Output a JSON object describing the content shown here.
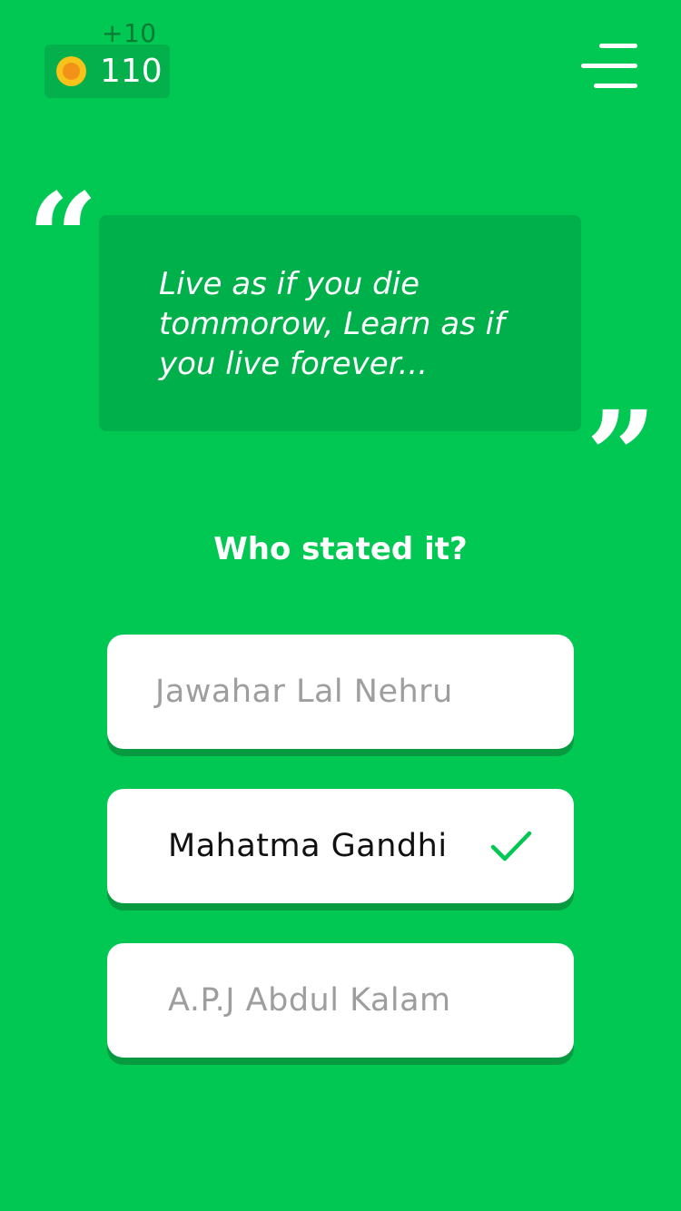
{
  "score": {
    "delta": "+10",
    "coins": "110",
    "coin_icon": "coin-icon"
  },
  "menu": {
    "icon": "menu-icon"
  },
  "quote": {
    "open_mark": "“",
    "close_mark": "”",
    "text": "Live as if you die tommorow, Learn as if you live forever..."
  },
  "question": "Who stated it?",
  "options": [
    {
      "label": "Jawahar Lal Nehru",
      "state": "unselected"
    },
    {
      "label": "Mahatma Gandhi",
      "state": "correct"
    },
    {
      "label": "A.P.J Abdul Kalam",
      "state": "unselected"
    }
  ],
  "colors": {
    "background": "#00c853",
    "card": "#00b04a",
    "check": "#00c853",
    "option_shadow": "#079a40"
  }
}
